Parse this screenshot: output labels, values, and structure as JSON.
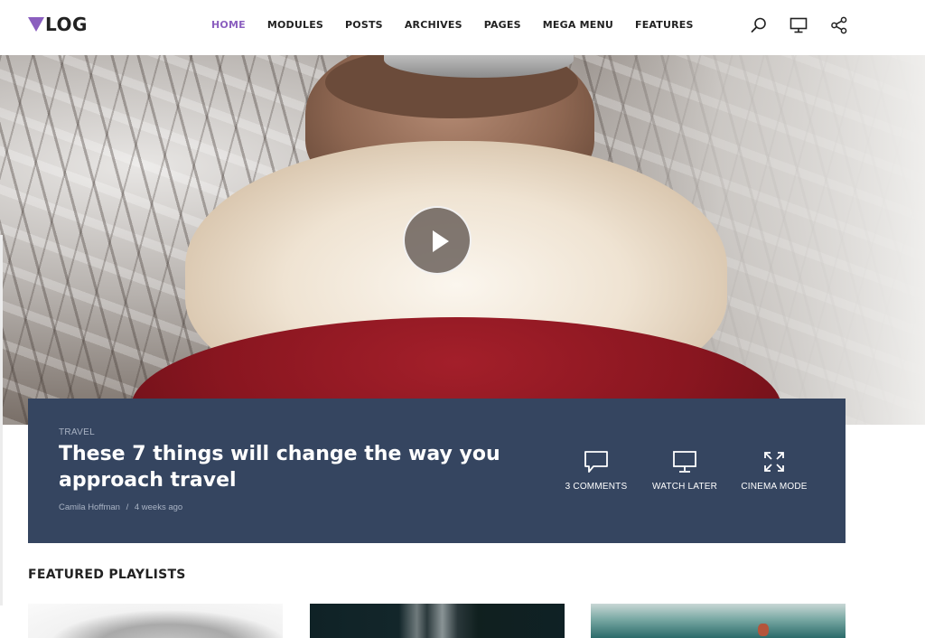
{
  "header": {
    "logo_text": "LOG",
    "nav": [
      "HOME",
      "MODULES",
      "POSTS",
      "ARCHIVES",
      "PAGES",
      "MEGA MENU",
      "FEATURES"
    ],
    "active_nav": "HOME",
    "icons": [
      "search-icon",
      "monitor-icon",
      "share-icon"
    ]
  },
  "hero": {
    "play_icon": "play-icon"
  },
  "feature": {
    "category": "TRAVEL",
    "title": "These 7 things will change the way you approach travel",
    "author": "Camila Hoffman",
    "separator": "/",
    "time": "4 weeks ago",
    "actions": [
      {
        "icon": "comment-icon",
        "label": "3 COMMENTS"
      },
      {
        "icon": "monitor-icon",
        "label": "WATCH LATER"
      },
      {
        "icon": "expand-icon",
        "label": "CINEMA MODE"
      }
    ]
  },
  "featured_playlists": {
    "title": "FEATURED PLAYLISTS"
  },
  "colors": {
    "accent": "#8b5fbf",
    "card_bg": "#354560"
  }
}
